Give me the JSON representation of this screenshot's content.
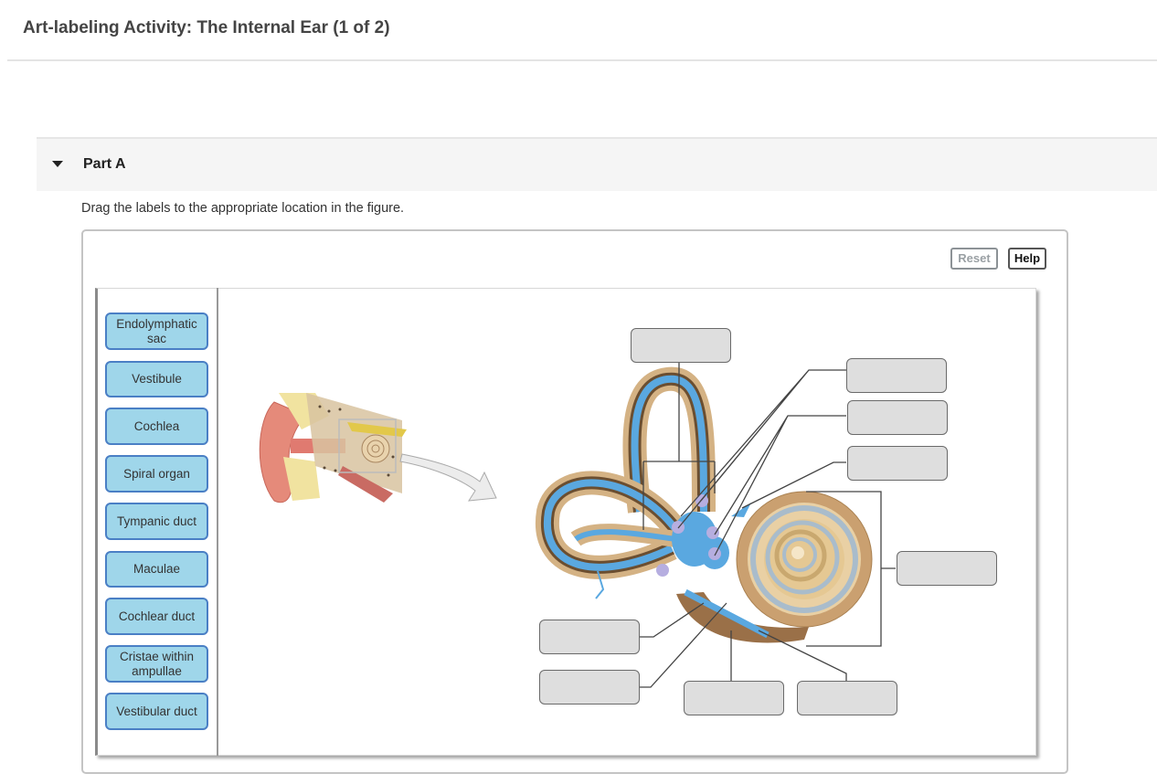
{
  "header": {
    "title": "Art-labeling Activity: The Internal Ear (1 of 2)"
  },
  "part": {
    "label": "Part A",
    "expanded": true,
    "caret_icon": "caret-down-icon"
  },
  "instructions": "Drag the labels to the appropriate location in the figure.",
  "toolbar": {
    "reset_label": "Reset",
    "help_label": "Help",
    "reset_enabled": false
  },
  "labels": [
    "Endolymphatic sac",
    "Vestibule",
    "Cochlea",
    "Spiral organ",
    "Tympanic duct",
    "Maculae",
    "Cochlear duct",
    "Cristae within ampullae",
    "Vestibular duct"
  ],
  "figure": {
    "overview_image": "outer-middle-inner-ear-illustration",
    "detail_image": "membranous-labyrinth-illustration",
    "drop_targets_count": 10,
    "drop_targets": [
      "",
      "",
      "",
      "",
      "",
      "",
      "",
      "",
      "",
      ""
    ]
  },
  "colors": {
    "label_fill": "#9fd6ea",
    "label_border": "#4a7fc5",
    "target_fill": "#dedede",
    "endolymph_blue": "#5aa8e0",
    "bone_tan": "#d9b98a"
  }
}
